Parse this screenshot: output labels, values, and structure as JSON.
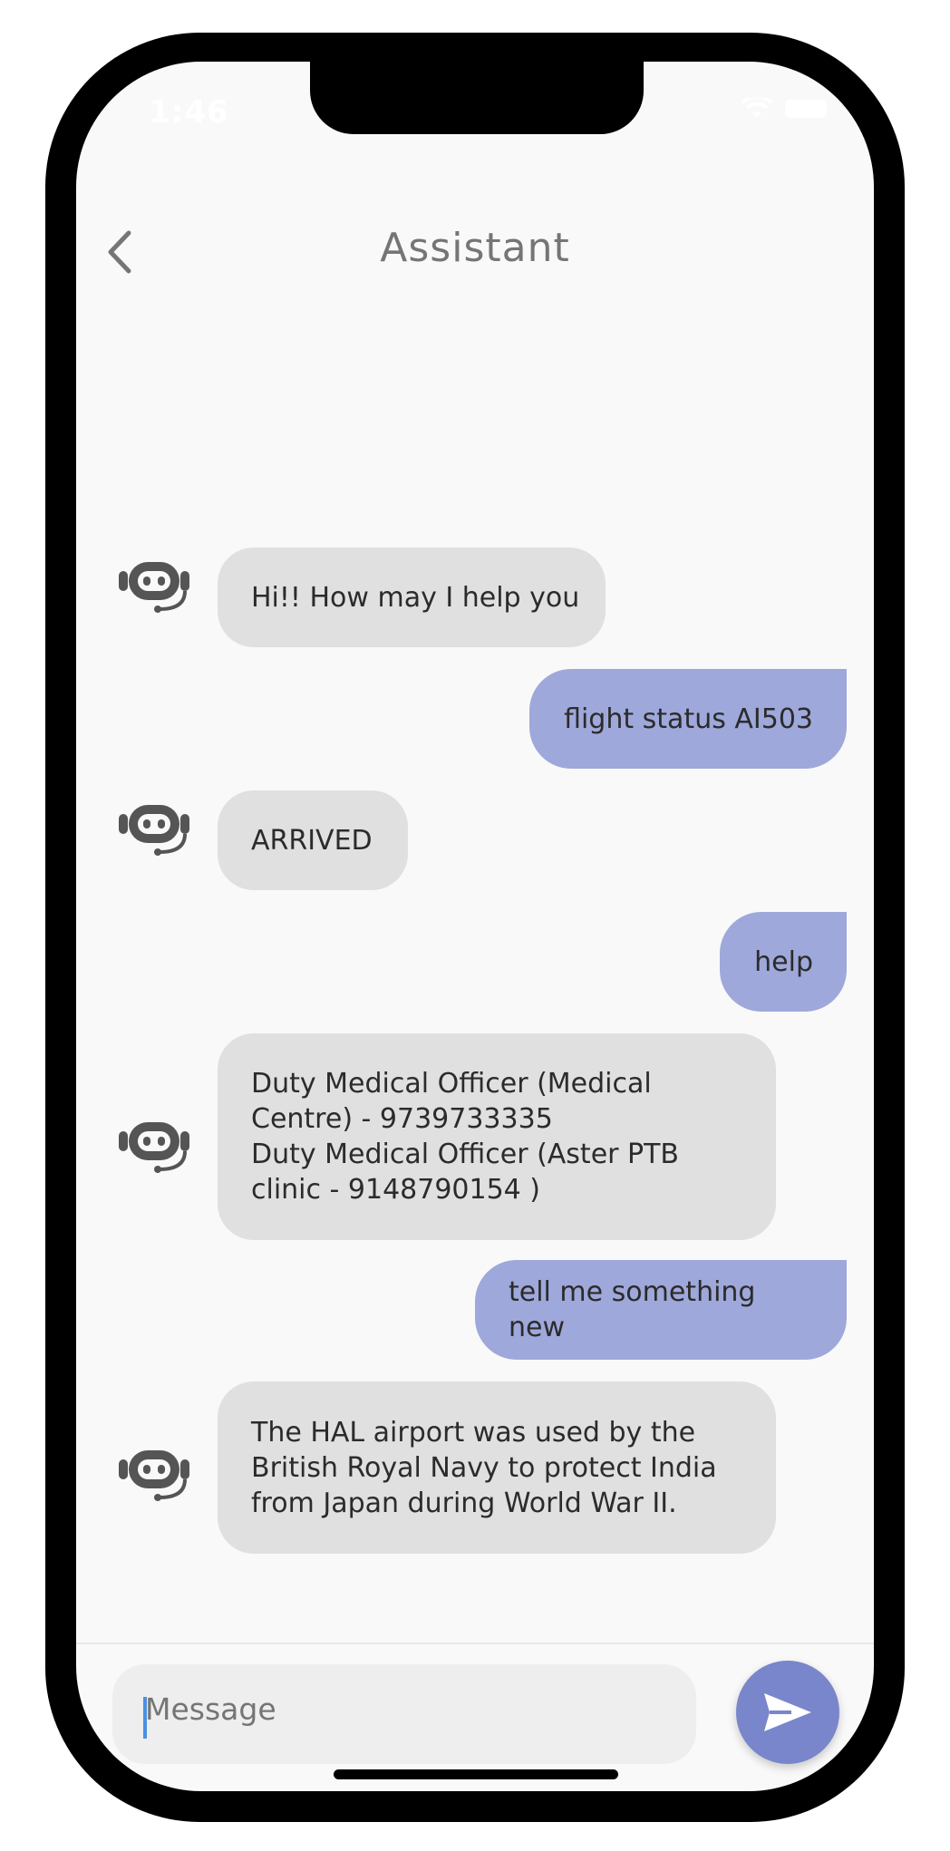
{
  "status_bar": {
    "time": "1:46"
  },
  "header": {
    "title": "Assistant"
  },
  "messages": [
    {
      "sender": "bot",
      "text": "Hi!! How may I help you"
    },
    {
      "sender": "user",
      "text": "flight status AI503"
    },
    {
      "sender": "bot",
      "text": "ARRIVED"
    },
    {
      "sender": "user",
      "text": "help"
    },
    {
      "sender": "bot",
      "lines": [
        "Duty Medical Officer (Medical",
        "Centre) - 9739733335",
        "Duty Medical Officer (Aster PTB",
        "clinic - 9148790154 )"
      ]
    },
    {
      "sender": "user",
      "text": "tell me something new"
    },
    {
      "sender": "bot",
      "lines": [
        "The HAL airport was used by the",
        "British Royal Navy to protect India",
        "from Japan during World War II."
      ]
    }
  ],
  "composer": {
    "placeholder": "Message"
  },
  "colors": {
    "user_bubble": "#9fa8da",
    "bot_bubble": "#e0e0e0",
    "send_button": "#7986cb"
  },
  "icons": {
    "back": "chevron-left-icon",
    "bot": "robot-headset-icon",
    "send": "send-icon"
  }
}
